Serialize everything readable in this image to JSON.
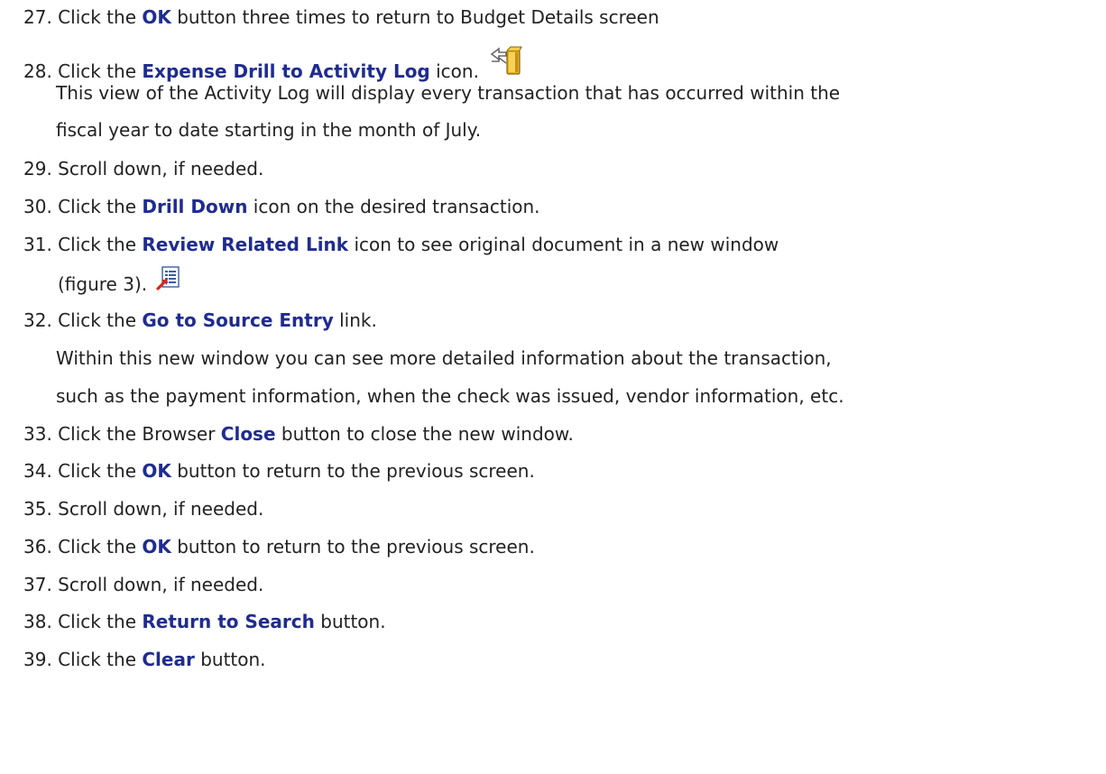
{
  "steps": {
    "s27": {
      "num": "27.",
      "pre": "Click the ",
      "bold": "OK",
      "post": " button three times to return to Budget Details screen"
    },
    "s28": {
      "num": "28.",
      "pre": "Click the ",
      "bold": "Expense Drill to Activity Log",
      "post": " icon.",
      "icon": "drill-to-activity-log-icon"
    },
    "s28_note1": "This view of the Activity Log will display every transaction that has occurred within the",
    "s28_note2": "fiscal year to date starting in the month of July.",
    "s29": {
      "num": "29.",
      "text": "Scroll down, if needed."
    },
    "s30": {
      "num": "30.",
      "pre": "Click the ",
      "bold": "Drill Down",
      "post": " icon on the desired transaction."
    },
    "s31": {
      "num": "31.",
      "pre": "Click the ",
      "bold": "Review Related Link",
      "post": " icon to see original document in a new window"
    },
    "s31_cont": "(figure 3).",
    "s31_icon": "review-related-link-icon",
    "s32": {
      "num": "32.",
      "pre": "Click the ",
      "bold": "Go to Source Entry",
      "post": " link."
    },
    "s32_note1": "Within this new window you can see more detailed information about the transaction,",
    "s32_note2": "such as the payment information, when the check was issued, vendor information, etc.",
    "s33": {
      "num": "33.",
      "pre": "Click the Browser ",
      "bold": "Close",
      "post": " button to close the new window."
    },
    "s34": {
      "num": "34.",
      "pre": "Click the ",
      "bold": "OK",
      "post": " button to return to the previous screen."
    },
    "s35": {
      "num": "35.",
      "text": "Scroll down, if needed."
    },
    "s36": {
      "num": "36.",
      "pre": "Click the ",
      "bold": "OK",
      "post": " button to return to the previous screen."
    },
    "s37": {
      "num": "37.",
      "text": "Scroll down, if needed."
    },
    "s38": {
      "num": "38.",
      "pre": "Click the ",
      "bold": "Return to Search",
      "post": " button."
    },
    "s39": {
      "num": "39.",
      "pre": "Click the ",
      "bold": "Clear",
      "post": " button."
    }
  },
  "colors": {
    "emphasis": "#1f2c8f",
    "text": "#222222"
  }
}
